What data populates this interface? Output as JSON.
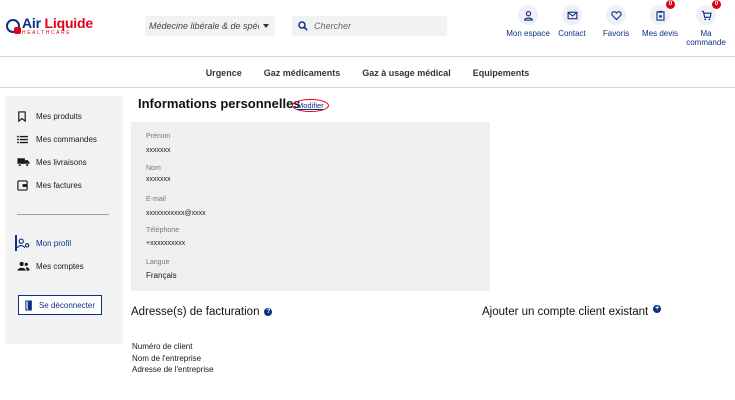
{
  "brand": {
    "name_blue": "Air",
    "name_red": " Liquide",
    "subtitle": "HEALTHCARE",
    "primary_color": "#0b2f87",
    "accent_color": "#e1001a"
  },
  "header": {
    "segment_value": "Médecine libérale & de spéci...",
    "search_placeholder": "Chercher",
    "nav": [
      {
        "label": "Mon espace",
        "icon": "user-icon",
        "badge": null
      },
      {
        "label": "Contact",
        "icon": "mail-icon",
        "badge": null
      },
      {
        "label": "Favoris",
        "icon": "heart-icon",
        "badge": null
      },
      {
        "label": "Mes devis",
        "icon": "clipboard-icon",
        "badge": "0"
      },
      {
        "label": "Ma commande",
        "icon": "cart-icon",
        "badge": "0"
      }
    ]
  },
  "categories": [
    "Urgence",
    "Gaz médicaments",
    "Gaz à usage médical",
    "Equipements"
  ],
  "sidebar": {
    "items": [
      {
        "label": "Mes produits",
        "icon": "bookmark-icon"
      },
      {
        "label": "Mes commandes",
        "icon": "list-icon"
      },
      {
        "label": "Mes livraisons",
        "icon": "truck-icon"
      },
      {
        "label": "Mes factures",
        "icon": "invoice-icon"
      }
    ],
    "account_items": [
      {
        "label": "Mon profil",
        "icon": "profile-settings-icon",
        "active": true
      },
      {
        "label": "Mes comptes",
        "icon": "group-icon",
        "active": false
      }
    ],
    "logout_label": "Se déconnecter"
  },
  "main": {
    "title": "Informations personnelles",
    "modify_label": "Modifier",
    "fields": [
      {
        "label": "Prénom",
        "value": "xxxxxxx"
      },
      {
        "label": "Nom",
        "value": "xxxxxxx"
      },
      {
        "label": "E-mail",
        "value": "xxxxxxxxxxx@xxxx"
      },
      {
        "label": "Téléphone",
        "value": "+xxxxxxxxxx"
      },
      {
        "label": "Langue",
        "value": "Français"
      }
    ],
    "billing_title": "Adresse(s) de facturation",
    "billing_help": "?",
    "add_account_title": "Ajouter un compte client existant",
    "add_account_icon": "+",
    "billing_lines": [
      "Numéro de client",
      "Nom de l'entreprise",
      "Adresse de l'entreprise"
    ]
  }
}
